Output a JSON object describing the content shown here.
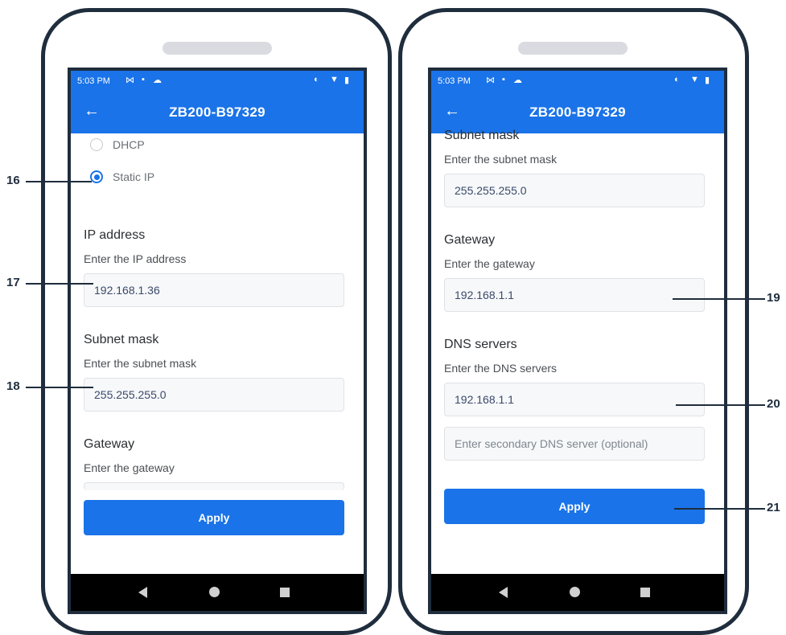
{
  "left_phone": {
    "status": {
      "time": "5:03 PM"
    },
    "appbar": {
      "title": "ZB200-B97329"
    },
    "radios": {
      "dhcp": "DHCP",
      "static": "Static IP"
    },
    "ip": {
      "title": "IP address",
      "hint": "Enter the IP address",
      "value": "192.168.1.36"
    },
    "subnet": {
      "title": "Subnet mask",
      "hint": "Enter the subnet mask",
      "value": "255.255.255.0"
    },
    "gateway": {
      "title": "Gateway",
      "hint": "Enter the gateway"
    },
    "apply_label": "Apply"
  },
  "right_phone": {
    "status": {
      "time": "5:03 PM"
    },
    "appbar": {
      "title": "ZB200-B97329"
    },
    "subnet": {
      "title": "Subnet mask",
      "hint": "Enter the subnet mask",
      "value": "255.255.255.0"
    },
    "gateway": {
      "title": "Gateway",
      "hint": "Enter the gateway",
      "value": "192.168.1.1"
    },
    "dns": {
      "title": "DNS servers",
      "hint": "Enter the DNS servers",
      "value": "192.168.1.1",
      "secondary_placeholder": "Enter secondary DNS server (optional)"
    },
    "apply_label": "Apply"
  },
  "callouts": {
    "c16": "16",
    "c17": "17",
    "c18": "18",
    "c19": "19",
    "c20": "20",
    "c21": "21"
  },
  "colors": {
    "accent": "#1a73e8",
    "frame": "#1f2d3d",
    "navbar": "#000000"
  },
  "icons": [
    "m-icon",
    "cast-icon",
    "cloud-icon",
    "sync-icon",
    "wifi-icon",
    "battery-icon",
    "back-arrow-icon"
  ]
}
